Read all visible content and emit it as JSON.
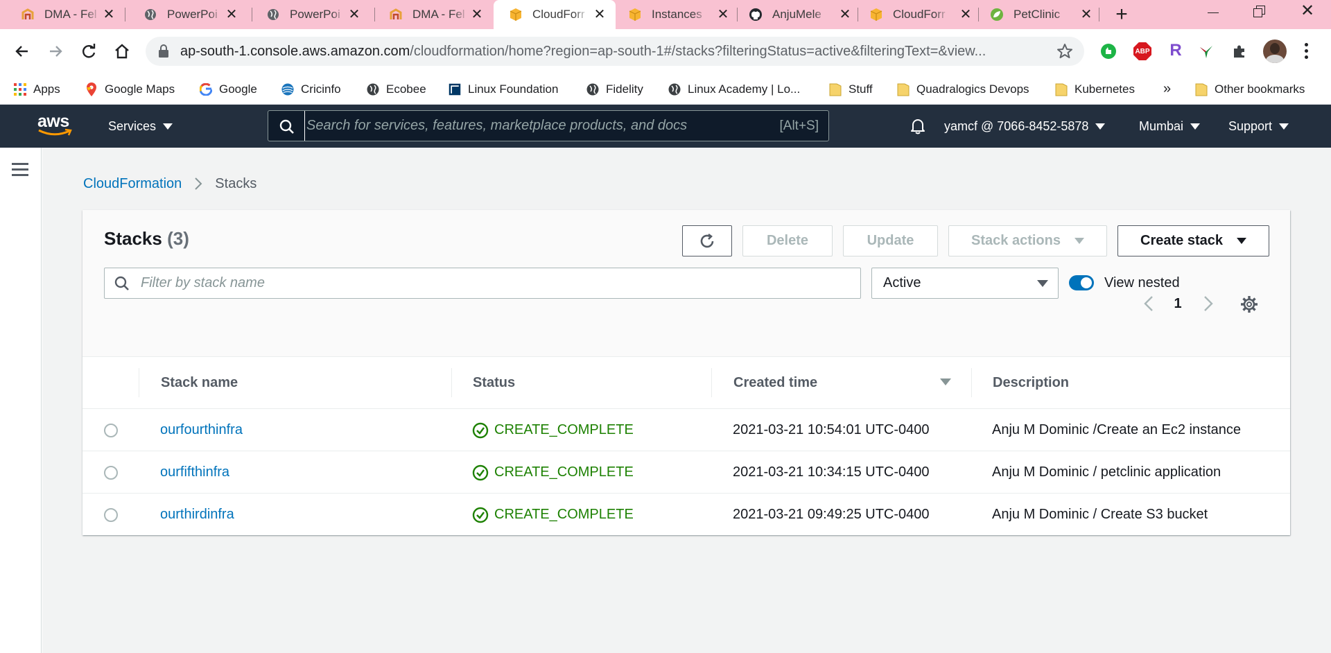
{
  "browser": {
    "tabs": [
      {
        "title": "DMA - Fel",
        "icon": "graduation-cap-icon",
        "active": false
      },
      {
        "title": "PowerPoi",
        "icon": "globe-icon",
        "active": false
      },
      {
        "title": "PowerPoi",
        "icon": "globe-icon",
        "active": false
      },
      {
        "title": "DMA - Fel",
        "icon": "graduation-cap-icon",
        "active": false
      },
      {
        "title": "CloudForr",
        "icon": "aws-box-icon",
        "active": true
      },
      {
        "title": "Instances",
        "icon": "aws-box-icon",
        "active": false
      },
      {
        "title": "AnjuMele",
        "icon": "github-icon",
        "active": false
      },
      {
        "title": "CloudForr",
        "icon": "aws-box-icon",
        "active": false
      },
      {
        "title": "PetClinic",
        "icon": "spring-leaf-icon",
        "active": false
      }
    ],
    "url_host": "ap-south-1.console.aws.amazon.com",
    "url_path": "/cloudformation/home?region=ap-south-1#/stacks?filteringStatus=active&filteringText=&view...",
    "bookmarks": [
      "Apps",
      "Google Maps",
      "Google",
      "Cricinfo",
      "Ecobee",
      "Linux Foundation",
      "Fidelity",
      "Linux Academy | Lo...",
      "Stuff",
      "Quadralogics Devops",
      "Kubernetes"
    ],
    "bookmarks_overflow": "»",
    "other_bookmarks": "Other bookmarks",
    "ext_abp": "ABP",
    "ext_r": "R"
  },
  "aws": {
    "logo": "aws",
    "services": "Services",
    "search_placeholder": "Search for services, features, marketplace products, and docs",
    "search_shortcut": "[Alt+S]",
    "account": "yamcf @ 7066-8452-5878",
    "region": "Mumbai",
    "support": "Support"
  },
  "breadcrumb": {
    "root": "CloudFormation",
    "current": "Stacks"
  },
  "stacks": {
    "title": "Stacks",
    "count": "(3)",
    "delete": "Delete",
    "update": "Update",
    "stack_actions": "Stack actions",
    "create_stack": "Create stack",
    "filter_placeholder": "Filter by stack name",
    "status_filter": "Active",
    "view_nested": "View nested",
    "page": "1",
    "columns": [
      "Stack name",
      "Status",
      "Created time",
      "Description"
    ],
    "rows": [
      {
        "name": "ourfourthinfra",
        "status": "CREATE_COMPLETE",
        "created": "2021-03-21 10:54:01 UTC-0400",
        "description": "Anju M Dominic /Create an Ec2 instance"
      },
      {
        "name": "ourfifthinfra",
        "status": "CREATE_COMPLETE",
        "created": "2021-03-21 10:34:15 UTC-0400",
        "description": "Anju M Dominic / petclinic application"
      },
      {
        "name": "ourthirdinfra",
        "status": "CREATE_COMPLETE",
        "created": "2021-03-21 09:49:25 UTC-0400",
        "description": "Anju M Dominic / Create S3 bucket"
      }
    ]
  },
  "colors": {
    "link": "#0073bb",
    "success": "#1d8102",
    "aws_nav": "#232f3e",
    "aws_orange": "#ff9900",
    "tabstrip": "#f9c2d2",
    "toggle": "#0073bb"
  }
}
